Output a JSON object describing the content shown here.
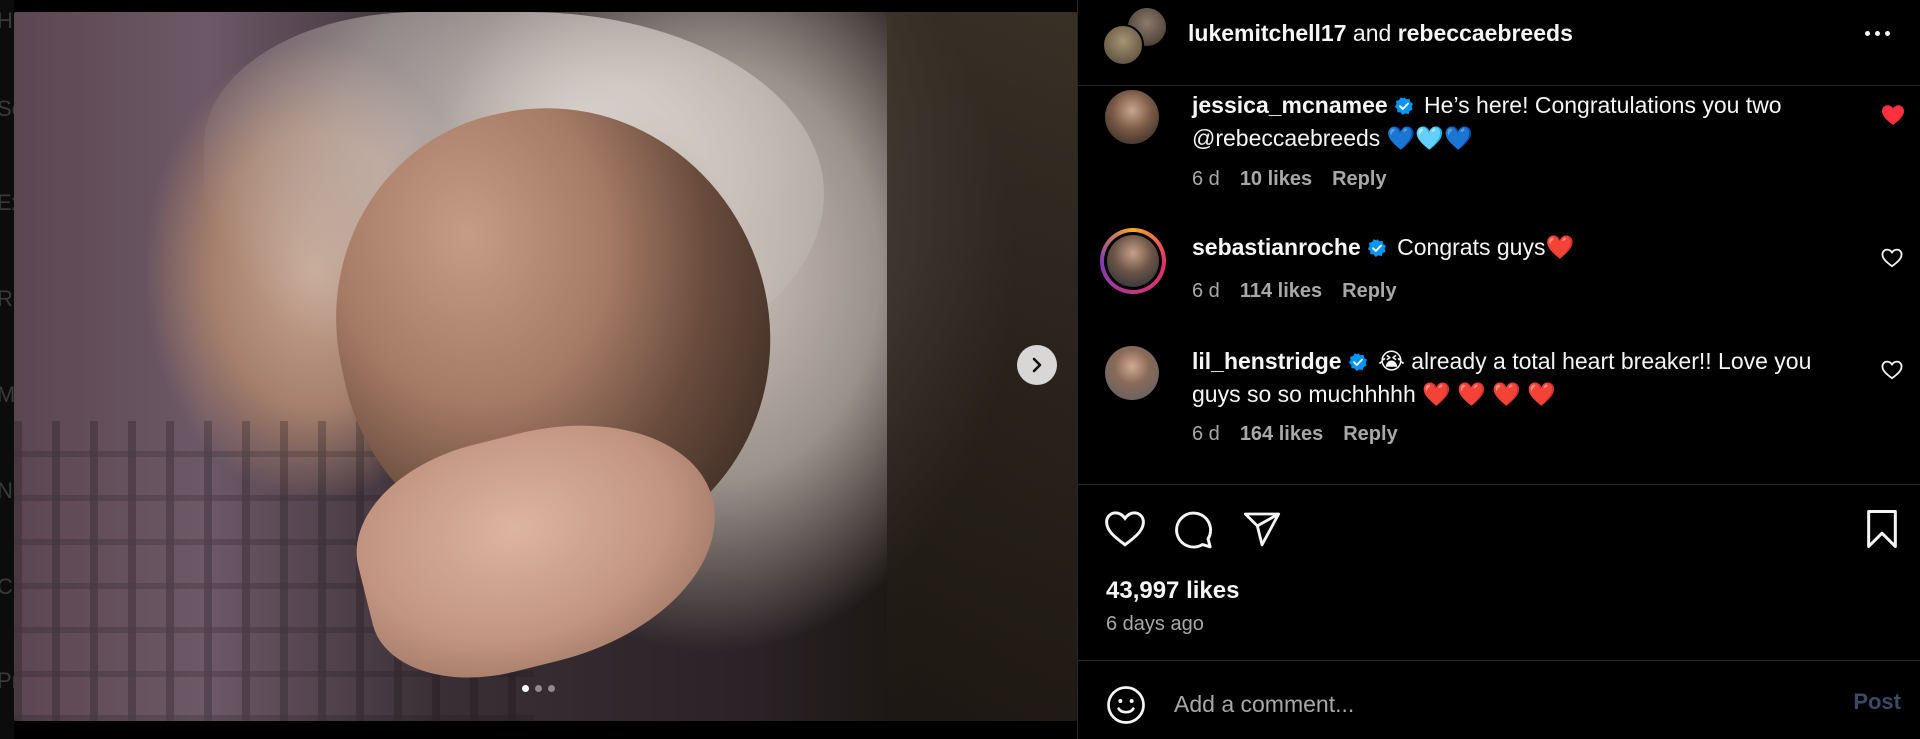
{
  "background_letters": [
    "He",
    "Se",
    "Ex",
    "Re",
    "M",
    "No",
    "Cr",
    "Pr"
  ],
  "post": {
    "carousel": {
      "total_slides": 3,
      "active_slide": 1
    },
    "header": {
      "user1": "lukemitchell17",
      "joiner": "and",
      "user2": "rebeccaebreeds"
    },
    "comments": [
      {
        "username": "jessica_mcnamee",
        "verified": true,
        "text_line1": "He’s here! Congratulations you two",
        "text_line2": "@rebeccaebreeds",
        "emojis": [
          "💙",
          "🩵",
          "💙"
        ],
        "time": "6 d",
        "likes": "10 likes",
        "reply": "Reply",
        "liked": true
      },
      {
        "username": "sebastianroche",
        "verified": true,
        "text": "Congrats guys",
        "emoji": "❤️",
        "time": "6 d",
        "likes": "114 likes",
        "reply": "Reply",
        "liked": false,
        "has_story_ring": true
      },
      {
        "username": "lil_henstridge",
        "verified": true,
        "emoji_lead": "😭",
        "text_line1": "already a total heart breaker!! Love you",
        "text_line2": "guys so so muchhhhh",
        "emojis": [
          "❤️",
          "❤️",
          "❤️",
          "❤️"
        ],
        "time": "6 d",
        "likes": "164 likes",
        "reply": "Reply",
        "liked": false
      }
    ],
    "likes_count": "43,997 likes",
    "time_ago": "6 days ago",
    "add_comment": {
      "placeholder": "Add a comment...",
      "post_label": "Post"
    }
  },
  "icons": {
    "next": "chevron-right-icon",
    "more": "more-horizontal-icon",
    "verified": "verified-badge-icon",
    "like": "heart-icon",
    "comment": "comment-bubble-icon",
    "share": "paper-plane-icon",
    "save": "bookmark-icon",
    "emoji": "smiley-icon"
  },
  "colors": {
    "background": "#000000",
    "text": "#f5f5f5",
    "muted": "#a8a8a8",
    "verified": "#0095f6",
    "liked_heart": "#ff3040",
    "post_disabled": "#3a4a66"
  }
}
